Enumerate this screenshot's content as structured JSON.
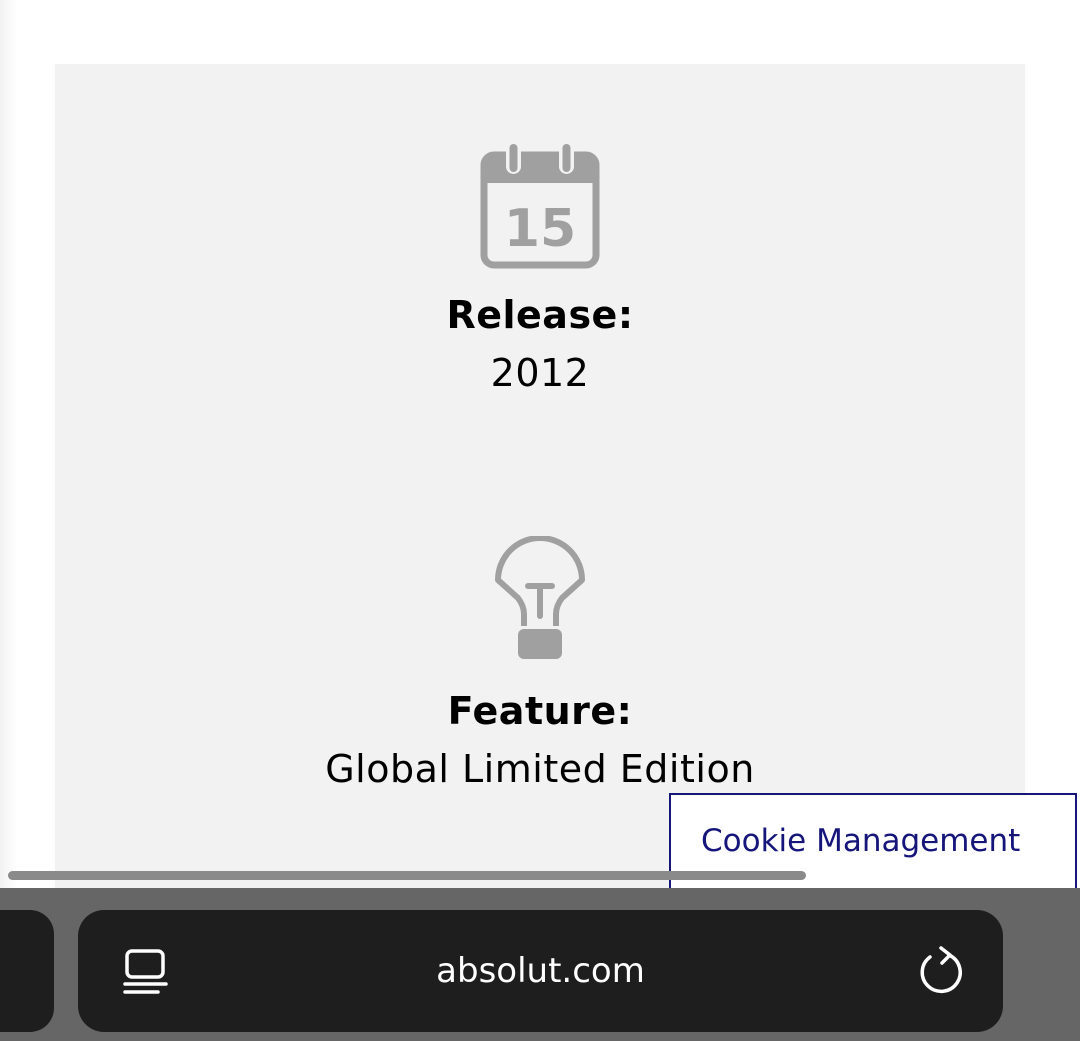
{
  "release": {
    "icon": "calendar-icon",
    "icon_day": "15",
    "label": "Release:",
    "value": "2012"
  },
  "feature": {
    "icon": "lightbulb-icon",
    "label": "Feature:",
    "value": "Global Limited Edition"
  },
  "cookie": {
    "label": "Cookie Management"
  },
  "browser": {
    "url": "absolut.com",
    "reader_icon": "reader-mode-icon",
    "reload_icon": "reload-icon"
  },
  "colors": {
    "panel_background": "#f2f2f2",
    "icon_gray": "#a0a0a0",
    "cookie_accent": "#15157a",
    "toolbar": "#666666",
    "address_bar": "#1e1e1e"
  }
}
